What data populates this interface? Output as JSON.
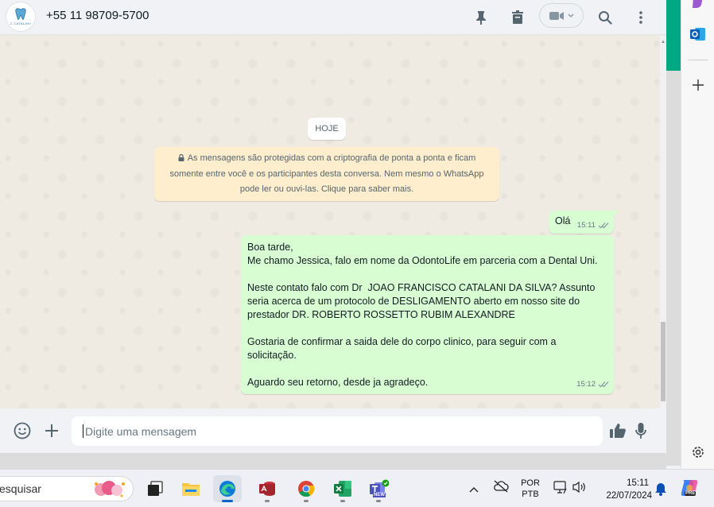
{
  "header": {
    "contact_name": "+55 11 98709-5700",
    "avatar_logo_text": "C CATALANI"
  },
  "chat": {
    "day_label": "HOJE",
    "encryption_notice": [
      "As mensagens são protegidas com a criptografia de ponta a ponta e ficam",
      "somente entre você e os participantes desta conversa. Nem mesmo o WhatsApp",
      "pode ler ou ouvi-las. Clique para saber mais."
    ],
    "messages": [
      {
        "text": "Olá",
        "time": "15:11"
      },
      {
        "lines": [
          "Boa tarde,",
          "Me chamo Jessica, falo em nome da OdontoLife em parceria com a Dental Uni.",
          "",
          "Neste contato falo com Dr  JOAO FRANCISCO CATALANI DA SILVA? Assunto",
          "seria acerca de um protocolo de DESLIGAMENTO aberto em nosso site do",
          "prestador DR. ROBERTO ROSSETTO RUBIM ALEXANDRE",
          "",
          "Gostaria de confirmar a saida dele do corpo clinico, para seguir com a",
          "solicitação.",
          "",
          "Aguardo seu retorno, desde ja agradeço."
        ],
        "time": "15:12"
      }
    ]
  },
  "composer": {
    "placeholder": "Digite uma mensagem"
  },
  "taskbar": {
    "search_text": "esquisar",
    "language_line1": "POR",
    "language_line2": "PTB",
    "clock_time": "15:11",
    "clock_date": "22/07/2024",
    "teams_badge": "NEW",
    "copilot_badge": "PRE"
  },
  "colors": {
    "bubble_out": "#d9fdd3",
    "chat_bg": "#efeae2",
    "notice_bg": "#ffeecd",
    "accent_green": "#00a884"
  }
}
